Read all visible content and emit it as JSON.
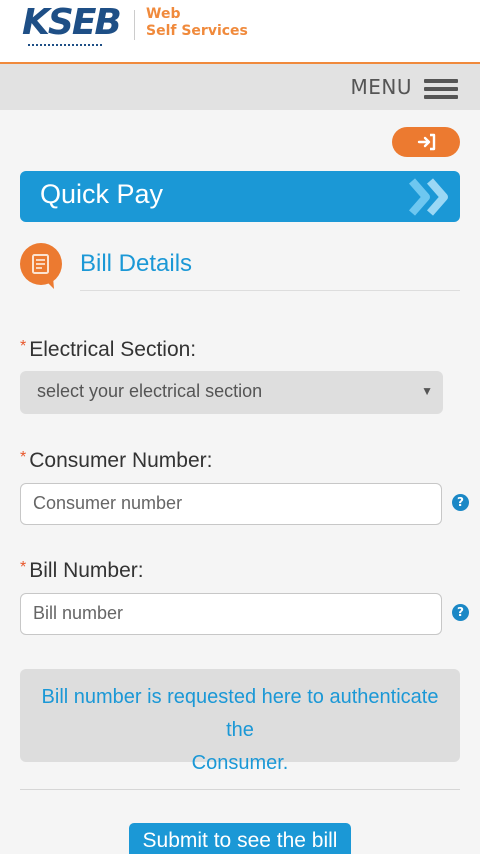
{
  "header": {
    "logo_text": "KSEB",
    "title_line1": "Web",
    "title_line2": "Self Services",
    "accent_color": "#f08a3c",
    "brand_color": "#1e4f86"
  },
  "menubar": {
    "menu_label": "MENU",
    "menu_icon": "hamburger-icon"
  },
  "logout": {
    "icon": "logout-icon"
  },
  "quickpay": {
    "title": "Quick Pay",
    "color": "#1b98d6",
    "icon": "double-chevron-right-icon"
  },
  "section": {
    "title": "Bill Details",
    "icon": "bill-document-icon"
  },
  "form": {
    "required_marker": "*",
    "electrical_section": {
      "label": "Electrical Section:",
      "value": "select your electrical section"
    },
    "consumer_number": {
      "label": "Consumer Number:",
      "placeholder": "Consumer number",
      "help": "?"
    },
    "bill_number": {
      "label": "Bill Number:",
      "placeholder": "Bill number",
      "help": "?"
    }
  },
  "info": {
    "line1": "Bill number is requested here to authenticate the",
    "line2": "Consumer."
  },
  "submit_label": "Submit to see the bill"
}
